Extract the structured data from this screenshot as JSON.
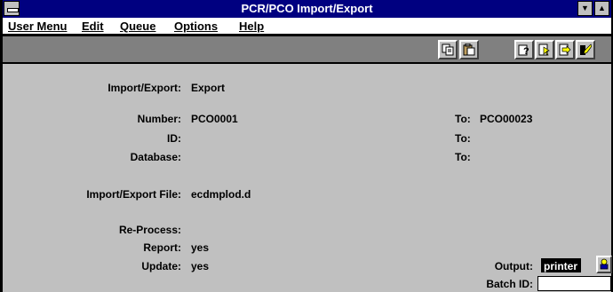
{
  "window": {
    "title": "PCR/PCO Import/Export"
  },
  "menu": {
    "items": [
      {
        "label": "User Menu"
      },
      {
        "label": "Edit"
      },
      {
        "label": "Queue"
      },
      {
        "label": "Options"
      },
      {
        "label": "Help"
      }
    ]
  },
  "toolbar": {
    "icons": [
      "copy-icon",
      "paste-icon",
      "query-icon",
      "edit-query-icon",
      "export-icon",
      "exit-icon"
    ]
  },
  "form": {
    "import_export_label": "Import/Export:",
    "import_export_value": "Export",
    "number_label": "Number:",
    "number_value": "PCO0001",
    "id_label": "ID:",
    "id_value": "",
    "database_label": "Database:",
    "database_value": "",
    "to_number_label": "To:",
    "to_number_value": "PCO00023",
    "to_id_label": "To:",
    "to_id_value": "",
    "to_database_label": "To:",
    "to_database_value": "",
    "file_label": "Import/Export File:",
    "file_value": "ecdmplod.d",
    "reprocess_label": "Re-Process:",
    "reprocess_value": "",
    "report_label": "Report:",
    "report_value": "yes",
    "update_label": "Update:",
    "update_value": "yes",
    "output_label": "Output:",
    "output_value": "printer",
    "batch_label": "Batch ID:",
    "batch_value": ""
  }
}
